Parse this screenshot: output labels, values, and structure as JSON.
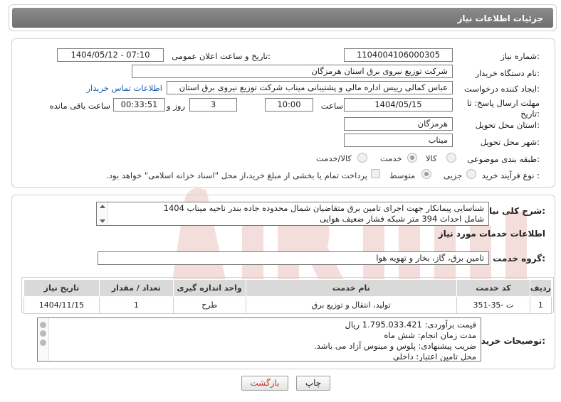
{
  "header": {
    "title": "جزئیات اطلاعات نیاز"
  },
  "form": {
    "need_number": {
      "label": "شماره نیاز:",
      "value": "1104004106000305"
    },
    "announce_datetime": {
      "label": "تاریخ و ساعت اعلان عمومی:",
      "value": "1404/05/12 - 07:10"
    },
    "buyer_org": {
      "label": "نام دستگاه خریدار:",
      "value": "شرکت توزیع نیروی برق استان هرمزگان"
    },
    "requester": {
      "label": "ایجاد کننده درخواست:",
      "value": "عباس کمالی رییس اداره مالی و پشتیبانی میناب شرکت توزیع نیروی برق استان",
      "contact_link": "اطلاعات تماس خریدار"
    },
    "deadline": {
      "label": "مهلت ارسال پاسخ: تا تاریخ:",
      "date": "1404/05/15",
      "time_label": "ساعت",
      "time": "10:00",
      "days": "3",
      "days_label": "روز و",
      "remaining": "00:33:51",
      "remaining_label": "ساعت باقی مانده"
    },
    "province": {
      "label": "استان محل تحویل:",
      "value": "هرمزگان"
    },
    "city": {
      "label": "شهر محل تحویل:",
      "value": "میناب"
    },
    "category": {
      "label": "طبقه بندی موضوعی:",
      "options": [
        "کالا",
        "خدمت",
        "کالا/خدمت"
      ],
      "selected": "خدمت"
    },
    "process_type": {
      "label": "نوع فرآیند خرید :",
      "options": [
        "جزیی",
        "متوسط"
      ],
      "selected": "متوسط",
      "payment_note": "پرداخت تمام یا بخشی از مبلغ خرید،از محل \"اسناد خزانه اسلامی\" خواهد بود."
    }
  },
  "description": {
    "label": "شرح کلی نیاز:",
    "lines": [
      "شناسایی پیمانکار جهت اجرای تامین برق متقاضیان شمال محدوده جاده بندر ناحیه میناب 1404",
      "شامل احداث 394 متر شبکه فشار ضعیف هوایی"
    ]
  },
  "services": {
    "section_title": "اطلاعات خدمات مورد نیاز",
    "group_label": "گروه خدمت:",
    "group_value": "تامین برق، گاز، بخار و تهویه هوا",
    "columns": [
      "ردیف",
      "کد خدمت",
      "نام خدمت",
      "واحد اندازه گیری",
      "تعداد / مقدار",
      "تاریخ نیاز"
    ],
    "rows": [
      {
        "row": "1",
        "code": "ت -35-351",
        "name": "تولید، انتقال و توزیع برق",
        "unit": "طرح",
        "qty": "1",
        "date": "1404/11/15"
      }
    ]
  },
  "buyer_notes": {
    "label": "توضیحات خریدار:",
    "lines": [
      "قیمت برآوردی:   1.795.033.421 ریال",
      "مدت زمان انجام: شش ماه",
      "ضریب پیشنهادی: پلوس و مینوس آزاد می باشد.",
      "محل تامین اعتبار: داخلی"
    ]
  },
  "buttons": {
    "print": "چاپ",
    "back": "بازگشت"
  },
  "colors": {
    "header_bar": "#7d7d7d",
    "link": "#1a5fb4",
    "back_text": "#c0392b",
    "watermark": "#c0392b"
  }
}
